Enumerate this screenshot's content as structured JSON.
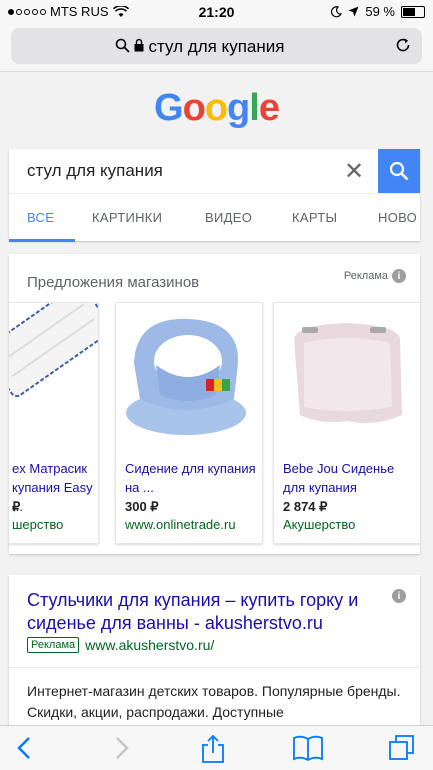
{
  "status": {
    "carrier": "MTS RUS",
    "time": "21:20",
    "battery": "59 %"
  },
  "browser": {
    "url": "стул для купания"
  },
  "logo": "Google",
  "search": {
    "query": "стул для купания",
    "tabs": [
      "ВСЕ",
      "КАРТИНКИ",
      "ВИДЕО",
      "КАРТЫ",
      "НОВО"
    ]
  },
  "shopping": {
    "title": "Предложения магазинов",
    "ad_label": "Реклама",
    "products": [
      {
        "name": "ex Матрасик купания Easy ...",
        "price": "₽",
        "store": "шерство"
      },
      {
        "name": "Сидение для купания на ...",
        "price": "300 ₽",
        "store": "www.onlinetrade.ru"
      },
      {
        "name": "Bebe Jou Сиденье для купания",
        "price": "2 874 ₽",
        "store": "Акушерство"
      }
    ]
  },
  "ad": {
    "title": "Стульчики для купания – купить горку и сиденье для ванны - akusherstvo.ru",
    "badge": "Реклама",
    "url": "www.akusherstvo.ru/",
    "description": "Интернет-магазин детских товаров. Популярные бренды. Скидки, акции, распродажи. Доступные"
  },
  "colors": {
    "google_blue": "#4285f4",
    "link": "#1a0dab",
    "url_green": "#006621"
  },
  "icons": [
    "wifi-icon",
    "moon-icon",
    "location-arrow-icon",
    "battery-icon",
    "search-icon",
    "lock-icon",
    "reload-icon",
    "close-icon",
    "info-icon",
    "back-icon",
    "forward-icon",
    "share-icon",
    "bookmarks-icon",
    "tabs-icon"
  ]
}
